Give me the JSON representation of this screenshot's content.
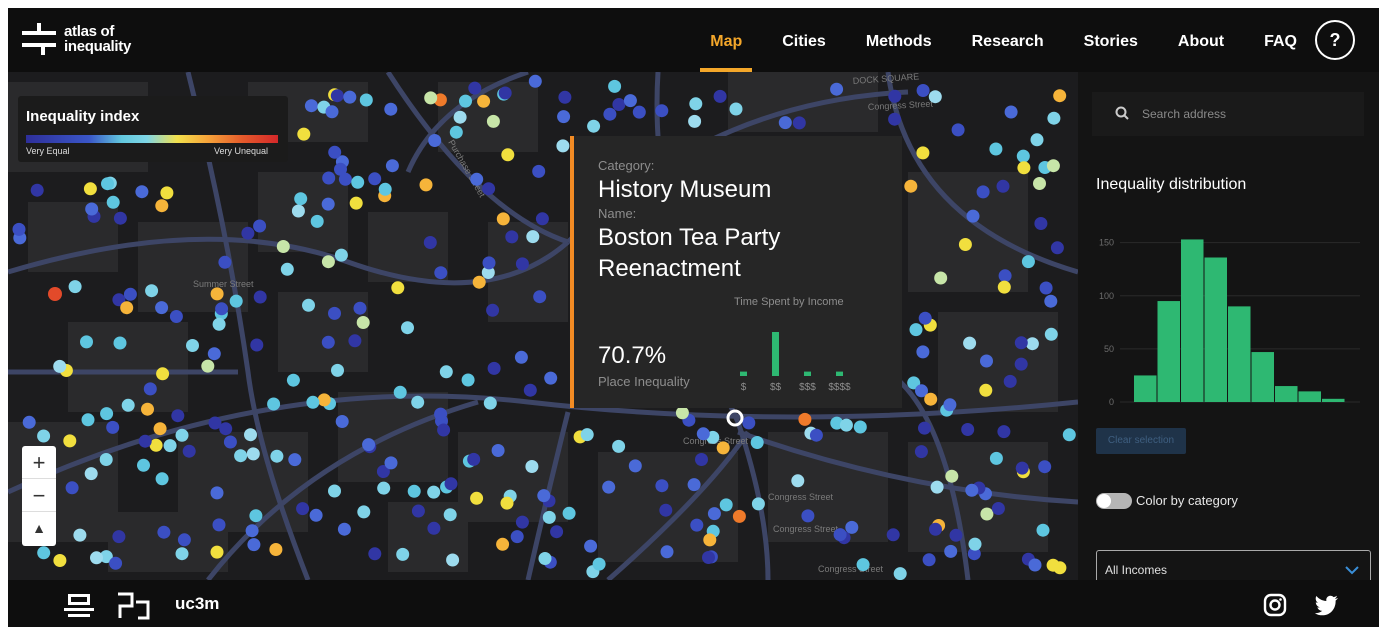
{
  "brand": {
    "line1": "atlas of",
    "line2": "inequality"
  },
  "nav": {
    "items": [
      {
        "label": "Map",
        "active": true
      },
      {
        "label": "Cities"
      },
      {
        "label": "Methods"
      },
      {
        "label": "Research"
      },
      {
        "label": "Stories"
      },
      {
        "label": "About"
      },
      {
        "label": "FAQ"
      }
    ],
    "help_label": "?"
  },
  "legend": {
    "title": "Inequality index",
    "low_label": "Very Equal",
    "high_label": "Very Unequal"
  },
  "popup": {
    "category_label": "Category:",
    "category_value": "History Museum",
    "name_label": "Name:",
    "name_value": "Boston Tea Party Reenactment",
    "percent": "70.7%",
    "percent_label": "Place Inequality",
    "time_spent_title": "Time Spent by Income",
    "income_bars": {
      "labels": [
        "$",
        "$$",
        "$$$",
        "$$$$"
      ],
      "values": [
        1,
        10,
        1,
        1
      ],
      "color": "#2eb872"
    }
  },
  "zoom": {
    "in": "+",
    "out": "−",
    "compass": "▲"
  },
  "sidebar": {
    "search_placeholder": "Search address",
    "distribution_title": "Inequality distribution",
    "histogram": {
      "y_ticks": [
        0,
        50,
        100,
        150
      ],
      "values": [
        25,
        95,
        153,
        136,
        90,
        47,
        15,
        10,
        3
      ],
      "ymax": 160,
      "color": "#2eb872"
    },
    "clear_label": "Clear selection",
    "color_by_category_label": "Color by category",
    "color_by_category_on": false,
    "income_select_value": "All Incomes"
  },
  "map_labels": [
    "DOCK SQUARE",
    "Congress Street",
    "Purchase Street",
    "Summer Street",
    "Congress Street",
    "Congress Street",
    "Congress Street",
    "Congress Street"
  ],
  "footer": {
    "uc3m": "uc3m"
  },
  "icons": {
    "search": "search-icon",
    "chevron": "chevron-down-icon",
    "instagram": "instagram-icon",
    "twitter": "twitter-icon",
    "logo": "atlas-logo-icon"
  },
  "colors": {
    "accent": "#f4a72a",
    "popup_border": "#f28b24",
    "background": "#111111",
    "green": "#2eb872"
  }
}
